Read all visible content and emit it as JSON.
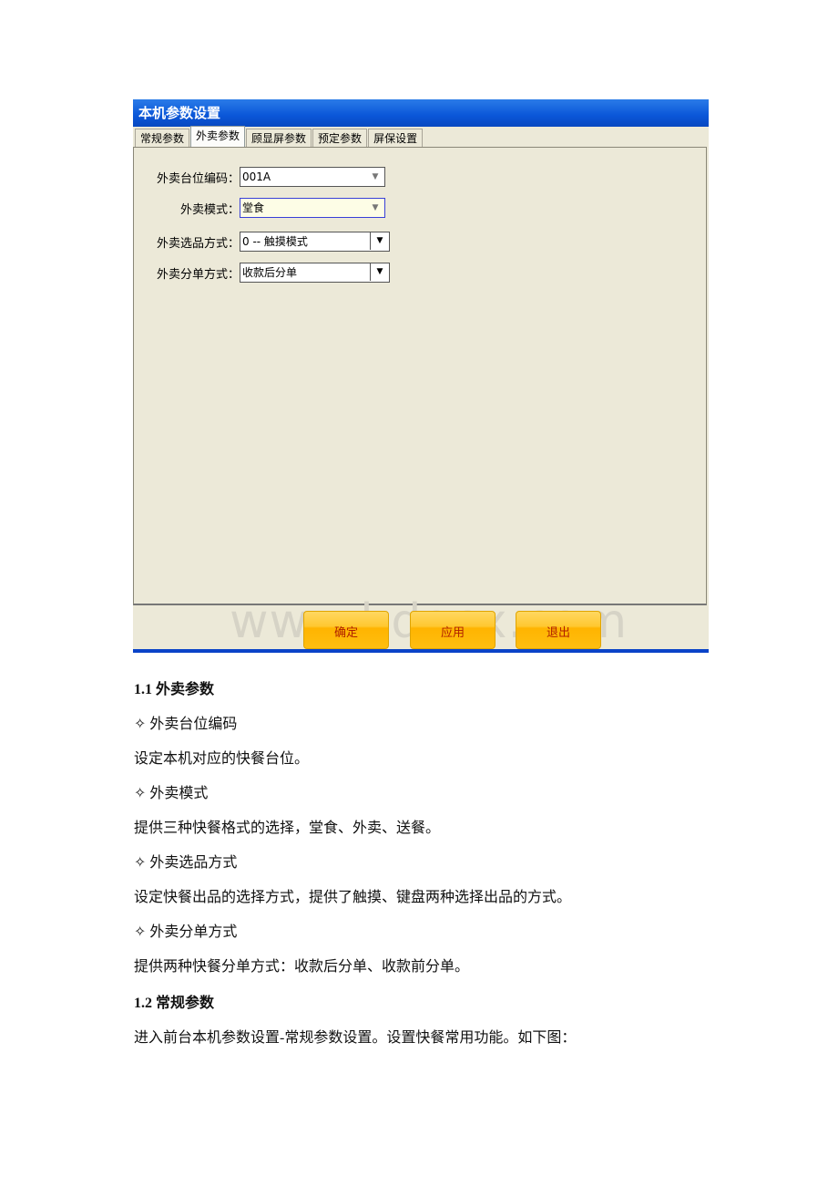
{
  "dialog": {
    "title": "本机参数设置",
    "tabs": [
      "常规参数",
      "外卖参数",
      "顾显屏参数",
      "预定参数",
      "屏保设置"
    ],
    "fields": [
      {
        "label": "外卖台位编码：",
        "value": "001A"
      },
      {
        "label": "外卖模式：",
        "value": "堂食"
      },
      {
        "label": "外卖选品方式：",
        "value": "0 -- 触摸模式"
      },
      {
        "label": "外卖分单方式：",
        "value": "收款后分单"
      }
    ],
    "buttons": {
      "ok": "确定",
      "apply": "应用",
      "exit": "退出"
    },
    "watermark": "www.bdocx.com"
  },
  "doc": {
    "h1": "1.1 外卖参数",
    "items": [
      {
        "title": "✧ 外卖台位编码",
        "desc": "设定本机对应的快餐台位。"
      },
      {
        "title": "✧ 外卖模式",
        "desc": "提供三种快餐格式的选择，堂食、外卖、送餐。"
      },
      {
        "title": "✧ 外卖选品方式",
        "desc": "设定快餐出品的选择方式，提供了触摸、键盘两种选择出品的方式。"
      },
      {
        "title": "✧ 外卖分单方式",
        "desc": "提供两种快餐分单方式：收款后分单、收款前分单。"
      }
    ],
    "h2": "1.2 常规参数",
    "p": "进入前台本机参数设置-常规参数设置。设置快餐常用功能。如下图："
  }
}
